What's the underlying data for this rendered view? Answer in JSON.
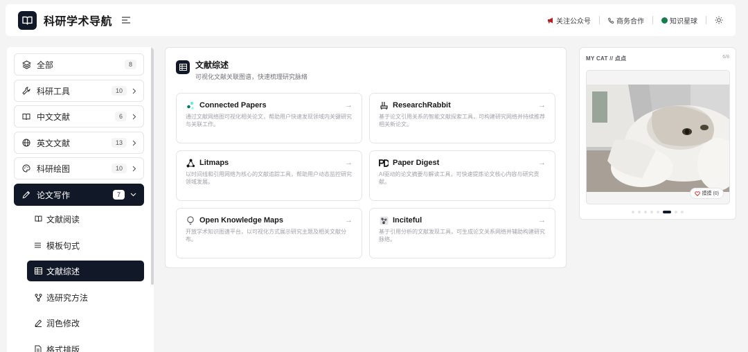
{
  "header": {
    "brand": "科研学术导航",
    "links": [
      "关注公众号",
      "商务合作",
      "知识星球"
    ]
  },
  "sidebar": {
    "items": [
      {
        "label": "全部",
        "count": "8",
        "icon": "layers-icon"
      },
      {
        "label": "科研工具",
        "count": "10",
        "icon": "wrench-icon"
      },
      {
        "label": "中文文献",
        "count": "6",
        "icon": "book-open-icon"
      },
      {
        "label": "英文文献",
        "count": "13",
        "icon": "globe-icon"
      },
      {
        "label": "科研绘图",
        "count": "10",
        "icon": "palette-icon"
      },
      {
        "label": "论文写作",
        "count": "7",
        "icon": "pen-icon"
      }
    ],
    "sub_items": [
      {
        "label": "文献阅读",
        "icon": "book-icon"
      },
      {
        "label": "模板句式",
        "icon": "list-icon"
      },
      {
        "label": "文献综述",
        "icon": "table-icon"
      },
      {
        "label": "选研究方法",
        "icon": "branch-icon"
      },
      {
        "label": "润色修改",
        "icon": "edit-icon"
      },
      {
        "label": "格式排版",
        "icon": "file-icon"
      }
    ]
  },
  "main": {
    "title": "文献综述",
    "subtitle": "可视化文献关联图谱，快速梳理研究脉络",
    "cards": [
      {
        "title": "Connected Papers",
        "desc": "通过文献网络图可视化相关论文，帮助用户快速发现领域内关键研究与关联工作。"
      },
      {
        "title": "ResearchRabbit",
        "desc": "基于论文引用关系的智能文献探索工具，可构建研究网络并持续推荐相关新论文。"
      },
      {
        "title": "Litmaps",
        "desc": "以时间线和引用网络为核心的文献追踪工具，帮助用户动态监控研究领域发展。"
      },
      {
        "title": "Paper Digest",
        "desc": "AI驱动的论文摘要与解读工具，可快速提炼论文核心内容与研究贡献。"
      },
      {
        "title": "Open Knowledge Maps",
        "desc": "开放学术知识图谱平台，以可视化方式展示研究主题及相关文献分布。"
      },
      {
        "title": "Inciteful",
        "desc": "基于引用分析的文献发现工具，可生成论文关系网络并辅助构建研究脉络。"
      }
    ]
  },
  "widget": {
    "title": "MY CAT // 点点",
    "counter": "6/8",
    "like_label": "摸摸 (0)",
    "current_slide": 6,
    "total_slides": 8
  },
  "colors": {
    "accent_dark": "#111827",
    "background": "#f4f4f5",
    "muted_text": "#a1a1aa"
  }
}
